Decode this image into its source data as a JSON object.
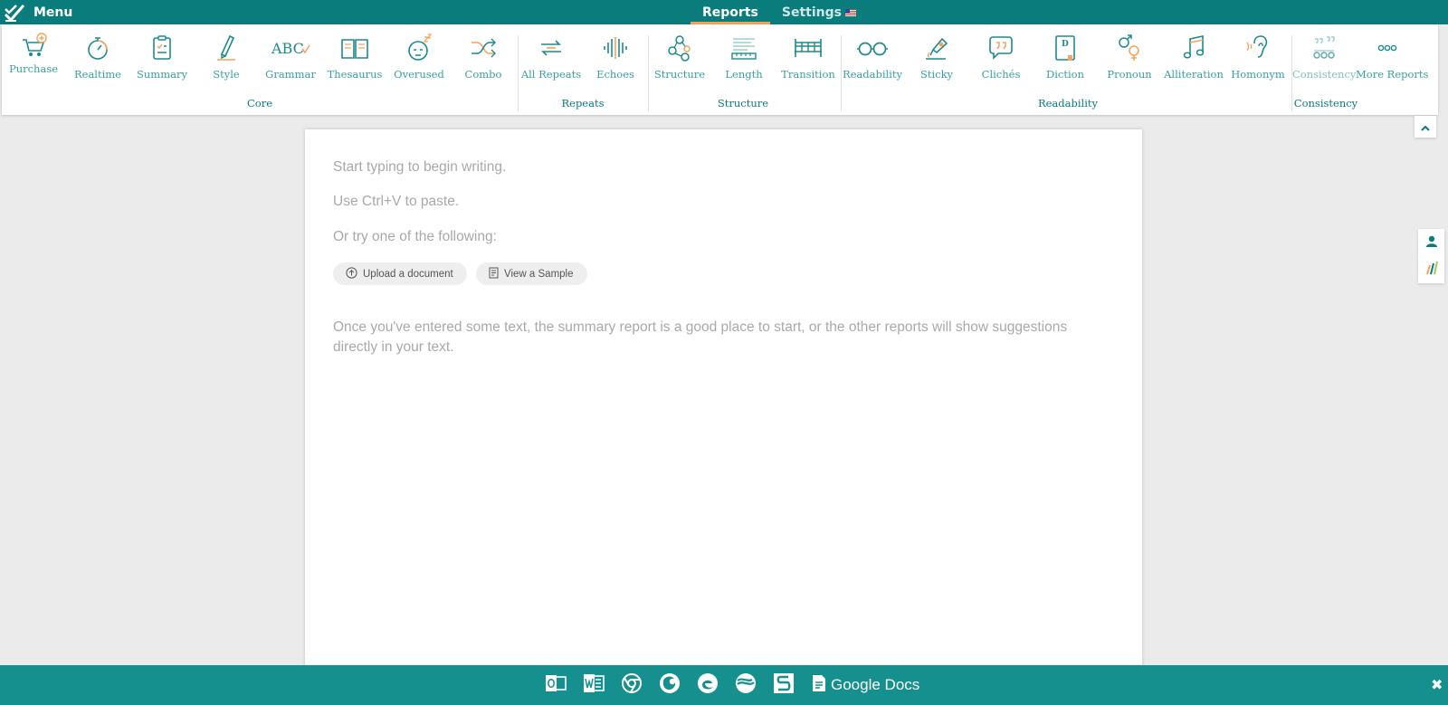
{
  "topbar": {
    "menu_label": "Menu",
    "tabs": [
      {
        "label": "Reports",
        "active": true
      },
      {
        "label": "Settings",
        "active": false
      }
    ]
  },
  "ribbon": {
    "buttons": {
      "purchase": "Purchase",
      "realtime": "Realtime",
      "summary": "Summary",
      "style": "Style",
      "grammar": "Grammar",
      "thesaurus": "Thesaurus",
      "overused": "Overused",
      "combo": "Combo",
      "all_repeats": "All Repeats",
      "echoes": "Echoes",
      "structure": "Structure",
      "length": "Length",
      "transition": "Transition",
      "readability": "Readability",
      "sticky": "Sticky",
      "cliches": "Clichés",
      "diction": "Diction",
      "pronoun": "Pronoun",
      "alliteration": "Alliteration",
      "homonym": "Homonym",
      "consistency": "Consistency",
      "more_reports": "More Reports"
    },
    "groups": {
      "core": "Core",
      "repeats": "Repeats",
      "structure": "Structure",
      "readability": "Readability",
      "consistency": "Consistency"
    },
    "icon_text": {
      "grammar": "ABC",
      "diction": "D"
    }
  },
  "editor": {
    "placeholder_1": "Start typing to begin writing.",
    "placeholder_2": "Use Ctrl+V to paste.",
    "placeholder_3": "Or try one of the following:",
    "upload_label": "Upload a document",
    "sample_label": "View a Sample",
    "hint": "Once you've entered some text, the summary report is a good place to start, or the other reports will show suggestions directly in your text."
  },
  "bottombar": {
    "google_docs_label": "Google Docs",
    "integrations": [
      "outlook-icon",
      "word-icon",
      "chrome-icon",
      "firefox-icon",
      "edge-icon",
      "safari-icon",
      "scrivener-icon"
    ],
    "close_glyph": "✖"
  },
  "colors": {
    "brand": "#0a7c7c",
    "accent": "#f2a35e",
    "icon_teal": "#1e8a8a",
    "bottom_bar": "#15908e"
  }
}
